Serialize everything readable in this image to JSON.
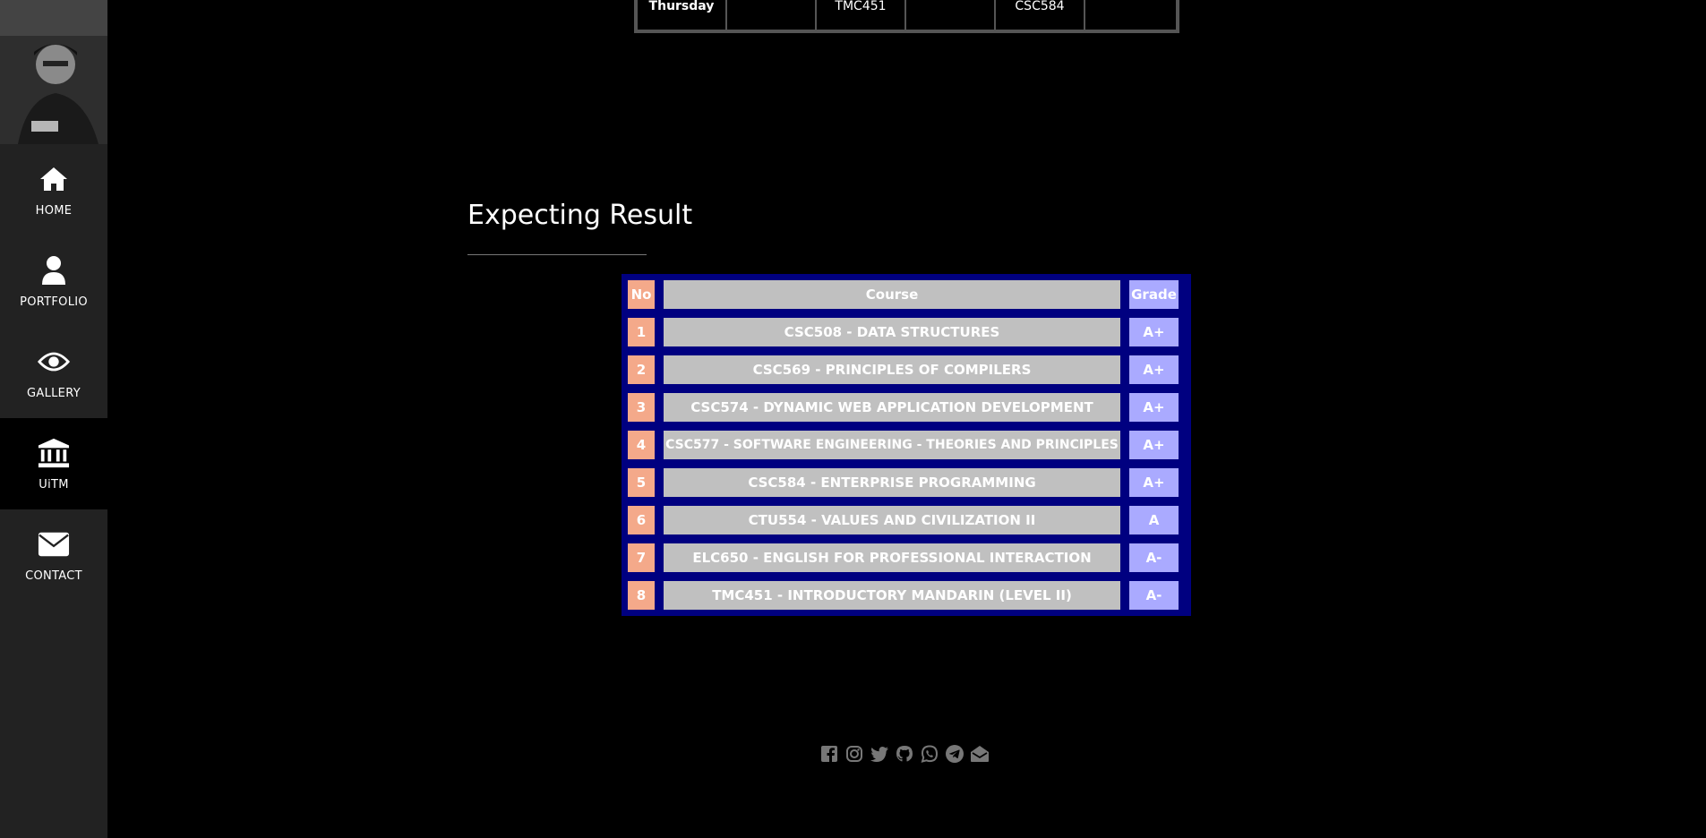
{
  "sidebar": {
    "items": [
      {
        "label": "HOME",
        "icon": "home-icon"
      },
      {
        "label": "PORTFOLIO",
        "icon": "user-icon"
      },
      {
        "label": "GALLERY",
        "icon": "eye-icon"
      },
      {
        "label": "UiTM",
        "icon": "university-icon",
        "active": true
      },
      {
        "label": "CONTACT",
        "icon": "envelope-icon"
      }
    ]
  },
  "timetable": {
    "row": [
      "Thursday",
      "",
      "TMC451",
      "",
      "CSC584",
      ""
    ]
  },
  "section": {
    "title": "Expecting Result"
  },
  "results": {
    "headers": {
      "no": "No",
      "course": "Course",
      "grade": "Grade"
    },
    "rows": [
      {
        "no": "1",
        "course": "CSC508 - DATA STRUCTURES",
        "grade": "A+"
      },
      {
        "no": "2",
        "course": "CSC569 - PRINCIPLES OF COMPILERS",
        "grade": "A+"
      },
      {
        "no": "3",
        "course": "CSC574 - DYNAMIC WEB APPLICATION DEVELOPMENT",
        "grade": "A+"
      },
      {
        "no": "4",
        "course": "CSC577 - SOFTWARE ENGINEERING - THEORIES AND PRINCIPLES",
        "grade": "A+"
      },
      {
        "no": "5",
        "course": "CSC584 - ENTERPRISE PROGRAMMING",
        "grade": "A+"
      },
      {
        "no": "6",
        "course": "CTU554 - VALUES AND CIVILIZATION II",
        "grade": "A"
      },
      {
        "no": "7",
        "course": "ELC650 - ENGLISH FOR PROFESSIONAL INTERACTION",
        "grade": "A-"
      },
      {
        "no": "8",
        "course": "TMC451 - INTRODUCTORY MANDARIN (LEVEL II)",
        "grade": "A-"
      }
    ]
  },
  "social": [
    "facebook-icon",
    "instagram-icon",
    "twitter-icon",
    "github-icon",
    "whatsapp-icon",
    "telegram-icon",
    "email-icon"
  ],
  "colors": {
    "sidebar_bg": "#222222",
    "table_border": "#000080",
    "no_cell": "#f4a98a",
    "course_cell": "#c0c0c0",
    "grade_cell": "#aaaaff"
  }
}
